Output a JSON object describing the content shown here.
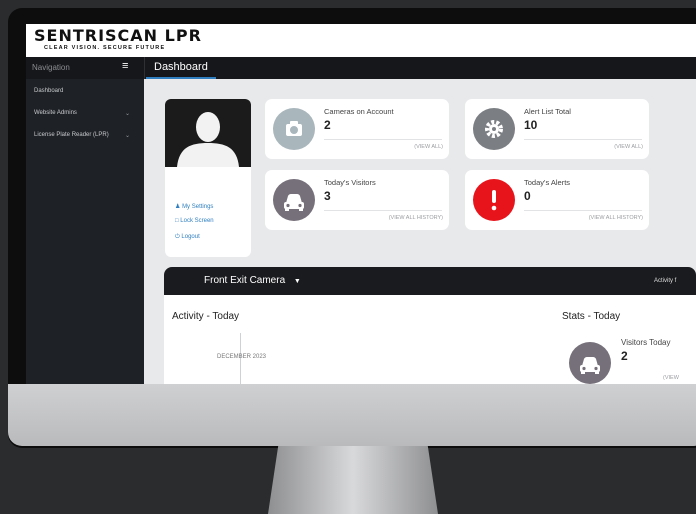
{
  "brand": {
    "name": "SENTRISCAN LPR",
    "tagline": "CLEAR VISION. SECURE FUTURE"
  },
  "navbar": {
    "nav_label": "Navigation",
    "page_title": "Dashboard"
  },
  "sidebar": {
    "items": [
      {
        "label": "Dashboard"
      },
      {
        "label": "Website Admins"
      },
      {
        "label": "License Plate Reader (LPR)"
      }
    ]
  },
  "profile": {
    "links": [
      {
        "label": "My Settings",
        "icon": "user-icon"
      },
      {
        "label": "Lock Screen",
        "icon": "lock-icon"
      },
      {
        "label": "Logout",
        "icon": "power-icon"
      }
    ]
  },
  "stats": {
    "cameras": {
      "label": "Cameras on Account",
      "value": "2",
      "link": "(VIEW ALL)",
      "icon": "camera-icon",
      "color": "#a9b6bc"
    },
    "alert_list": {
      "label": "Alert List Total",
      "value": "10",
      "link": "(VIEW ALL)",
      "icon": "gear-icon",
      "color": "#7b7e83"
    },
    "visitors": {
      "label": "Today's Visitors",
      "value": "3",
      "link": "(VIEW ALL HISTORY)",
      "icon": "car-icon",
      "color": "#76707a"
    },
    "alerts": {
      "label": "Today's Alerts",
      "value": "0",
      "link": "(VIEW ALL HISTORY)",
      "icon": "exclamation-icon",
      "color": "#e8141b"
    }
  },
  "camera": {
    "selected": "Front Exit Camera",
    "right_label": "Activity f",
    "activity_title": "Activity - Today",
    "timeline_date": "DECEMBER 2023",
    "stats_title": "Stats - Today",
    "visitors_label": "Visitors Today",
    "visitors_value": "2",
    "visitors_link": "(VIEW"
  }
}
